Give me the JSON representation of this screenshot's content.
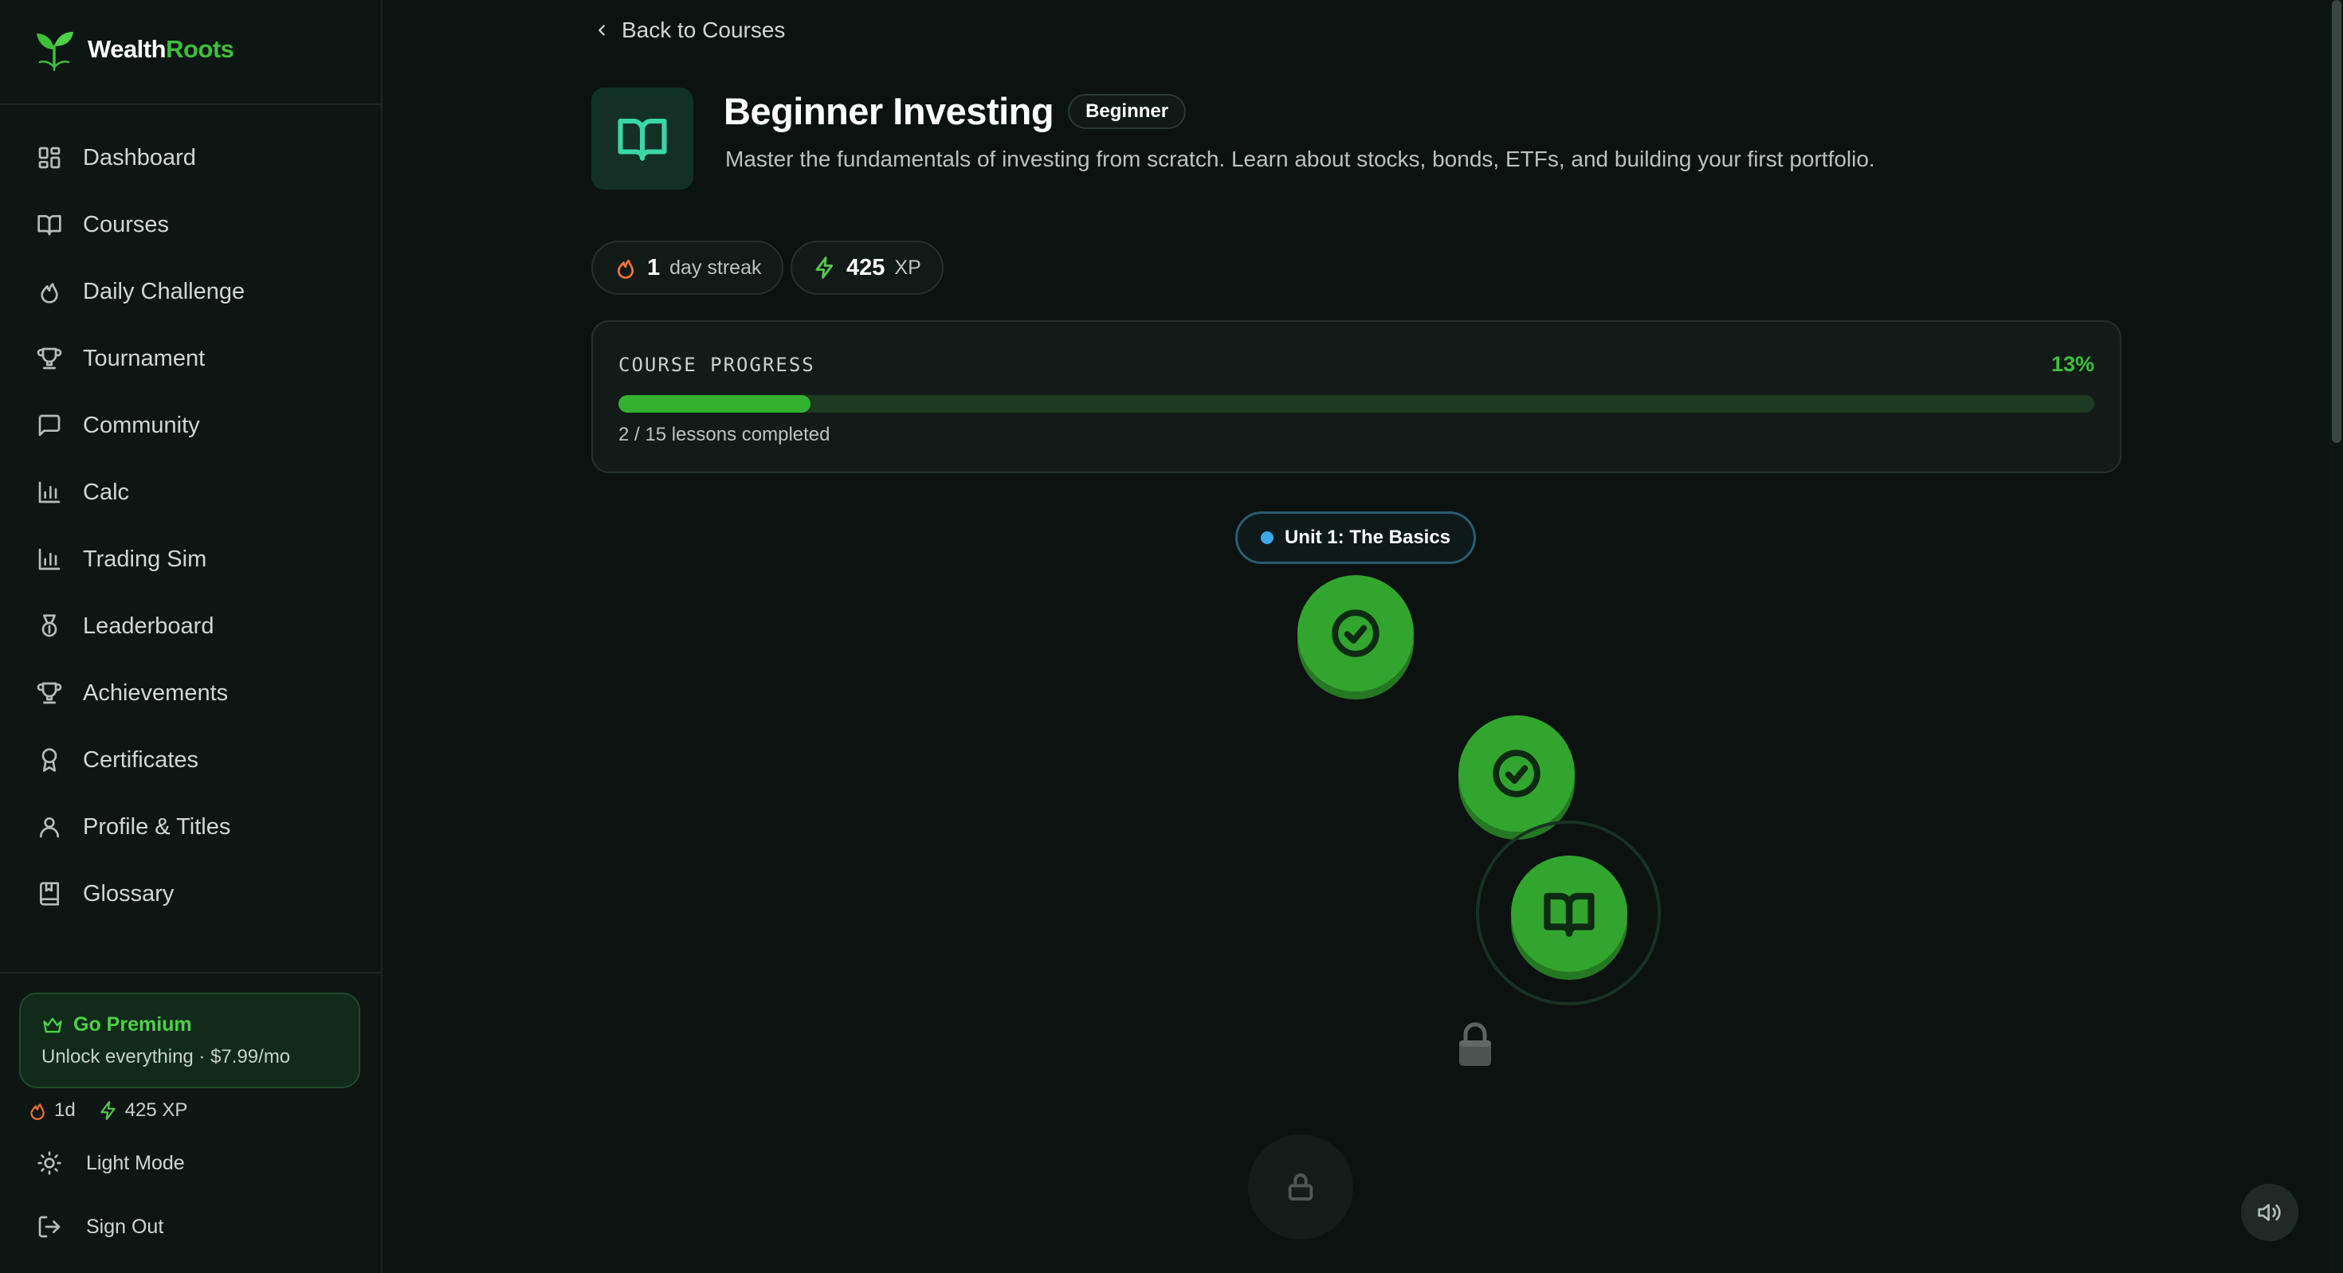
{
  "app": {
    "logo_part1": "Wealth",
    "logo_part2": "Roots"
  },
  "sidebar": {
    "items": [
      {
        "label": "Dashboard",
        "icon": "grid-icon"
      },
      {
        "label": "Courses",
        "icon": "book-icon"
      },
      {
        "label": "Daily Challenge",
        "icon": "flame-icon"
      },
      {
        "label": "Tournament",
        "icon": "trophy-icon"
      },
      {
        "label": "Community",
        "icon": "chat-icon"
      },
      {
        "label": "Calc",
        "icon": "bar-chart-icon"
      },
      {
        "label": "Trading Sim",
        "icon": "bar-chart-icon"
      },
      {
        "label": "Leaderboard",
        "icon": "medal-icon"
      },
      {
        "label": "Achievements",
        "icon": "trophy-icon"
      },
      {
        "label": "Certificates",
        "icon": "award-icon"
      },
      {
        "label": "Profile & Titles",
        "icon": "user-icon"
      },
      {
        "label": "Glossary",
        "icon": "bookmark-book-icon"
      }
    ],
    "premium_title": "Go Premium",
    "premium_sub": "Unlock everything · $7.99/mo",
    "streak_short": "1d",
    "xp_short": "425 XP",
    "light_mode_label": "Light Mode",
    "sign_out_label": "Sign Out"
  },
  "main": {
    "back_label": "Back to Courses",
    "course_title": "Beginner Investing",
    "level_badge": "Beginner",
    "description": "Master the fundamentals of investing from scratch. Learn about stocks, bonds, ETFs, and building your first portfolio.",
    "streak_value": "1",
    "streak_unit": "day streak",
    "xp_value": "425",
    "xp_unit": "XP",
    "progress_label": "COURSE PROGRESS",
    "progress_percent_text": "13%",
    "progress_fraction": 0.13,
    "lessons_completed_text": "2 / 15 lessons completed",
    "unit_label": "Unit 1: The Basics"
  },
  "colors": {
    "accent_green": "#3fbf3c",
    "flame": "#f2733a",
    "xp_bolt": "#57c84d",
    "unit_dot": "#3fa6e8"
  }
}
